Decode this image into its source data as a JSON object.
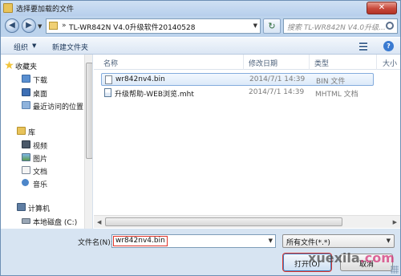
{
  "window": {
    "title": "选择要加载的文件",
    "close_glyph": "✕"
  },
  "address": {
    "path": "TL-WR842N V4.0升级软件20140528",
    "separator": "»",
    "search_placeholder": "搜索 TL-WR842N V4.0升级..."
  },
  "toolbar": {
    "organize_label": "组织",
    "new_folder_label": "新建文件夹"
  },
  "sidebar": {
    "items": [
      {
        "label": "收藏夹",
        "icon": "star-icon"
      },
      {
        "label": "下载",
        "icon": "download-folder-icon"
      },
      {
        "label": "桌面",
        "icon": "desktop-icon"
      },
      {
        "label": "最近访问的位置",
        "icon": "recent-places-icon"
      },
      {
        "label": "库",
        "icon": "library-icon"
      },
      {
        "label": "视频",
        "icon": "video-icon"
      },
      {
        "label": "图片",
        "icon": "pictures-icon"
      },
      {
        "label": "文档",
        "icon": "documents-icon"
      },
      {
        "label": "音乐",
        "icon": "music-icon"
      },
      {
        "label": "计算机",
        "icon": "computer-icon"
      },
      {
        "label": "本地磁盘 (C:)",
        "icon": "drive-icon"
      }
    ]
  },
  "file_list": {
    "columns": [
      "名称",
      "修改日期",
      "类型",
      "大小"
    ],
    "rows": [
      {
        "name": "wr842nv4.bin",
        "date": "2014/7/1 14:39",
        "type": "BIN 文件",
        "selected": true
      },
      {
        "name": "升级帮助-WEB浏览.mht",
        "date": "2014/7/1 14:39",
        "type": "MHTML 文档",
        "selected": false
      }
    ]
  },
  "bottom": {
    "filename_label": "文件名(N):",
    "filename_value": "wr842nv4.bin",
    "filetype_value": "所有文件(*.*)",
    "open_label": "打开(O)",
    "cancel_label": "取消"
  },
  "watermark": {
    "main": "xuexila",
    "suffix": ".com"
  },
  "colors": {
    "accent": "#3d7bbf",
    "highlight_border": "#e0352b",
    "selection_bg": "#dceaf9"
  }
}
